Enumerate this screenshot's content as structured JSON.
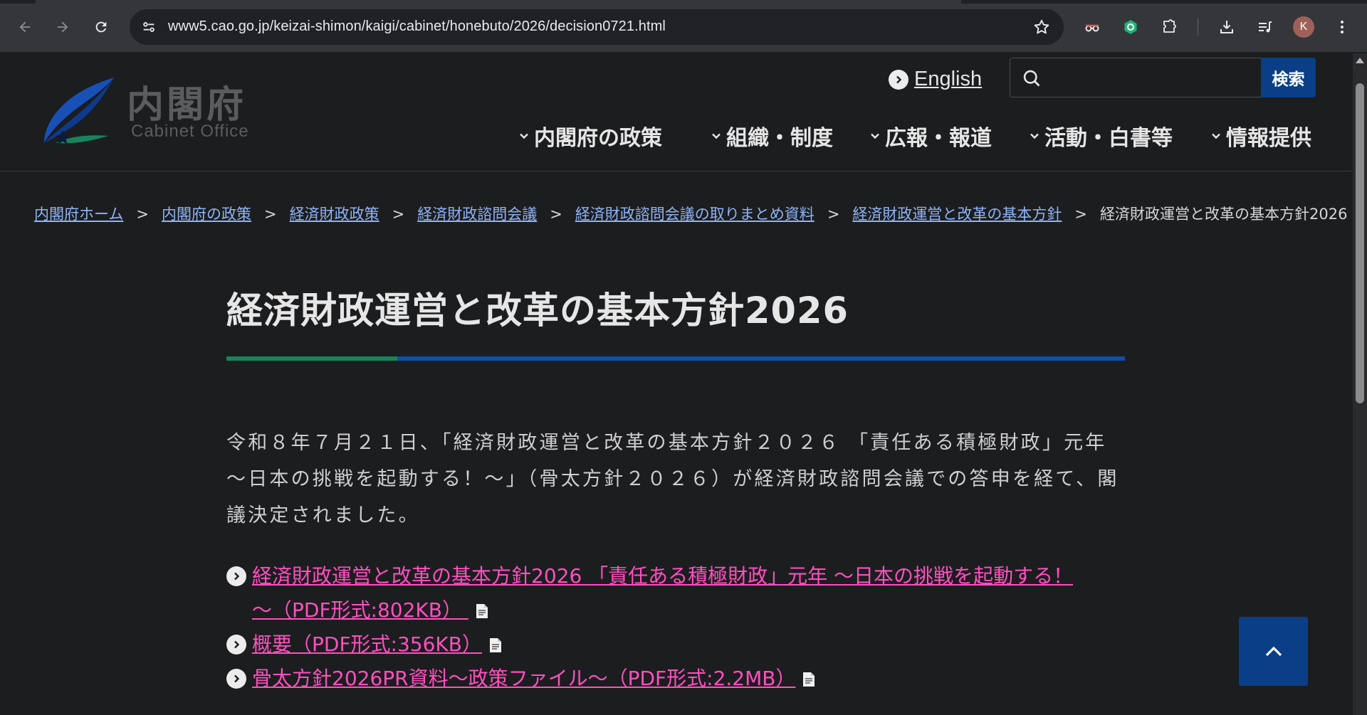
{
  "browser": {
    "url": "www5.cao.go.jp/keizai-shimon/kaigi/cabinet/honebuto/2026/decision0721.html",
    "profile_initial": "K",
    "icons": [
      "back-icon",
      "forward-icon",
      "reload-icon",
      "site-info-icon",
      "bookmark-star-icon",
      "incognito-glasses-icon",
      "extension-green-icon",
      "extensions-puzzle-icon",
      "download-icon",
      "reading-list-icon",
      "menu-dots-icon"
    ]
  },
  "header": {
    "logo_jp": "内閣府",
    "logo_en": "Cabinet Office",
    "english_link": "English",
    "search_placeholder": "",
    "search_button": "検索"
  },
  "global_nav": [
    {
      "label": "内閣府の政策"
    },
    {
      "label": "組織・制度"
    },
    {
      "label": "広報・報道"
    },
    {
      "label": "活動・白書等"
    },
    {
      "label": "情報提供"
    }
  ],
  "breadcrumb": {
    "links": [
      "内閣府ホーム",
      "内閣府の政策",
      "経済財政政策",
      "経済財政諮問会議",
      "経済財政諮問会議の取りまとめ資料",
      "経済財政運営と改革の基本方針"
    ],
    "separator": ">",
    "current": "経済財政運営と改革の基本方針2026"
  },
  "main": {
    "title": "経済財政運営と改革の基本方針2026",
    "lead_lines": [
      "令和８年７月２１日、「経済財政運営と改革の基本方針２０２６ 「責任ある積極財政」元年",
      "～日本の挑戦を起動する！～」（骨太方針２０２６）が経済財政諮問会議での答申を経て、閣",
      "議決定されました。"
    ],
    "documents": [
      {
        "lines": [
          "経済財政運営と改革の基本方針2026 「責任ある積極財政」元年 ～日本の挑戦を起動する！",
          "～（PDF形式:802KB）"
        ]
      },
      {
        "lines": [
          "概要（PDF形式:356KB）"
        ]
      },
      {
        "lines": [
          "骨太方針2026PR資料～政策ファイル～（PDF形式:2.2MB）"
        ]
      }
    ]
  },
  "colors": {
    "page_bg": "#1c1d1f",
    "link_blue": "#8fb4f5",
    "doc_link_pink": "#ff4fc0",
    "button_blue": "#0a3f87",
    "title_bar_blue": "#0e50a8",
    "title_bar_green": "#17845c"
  }
}
